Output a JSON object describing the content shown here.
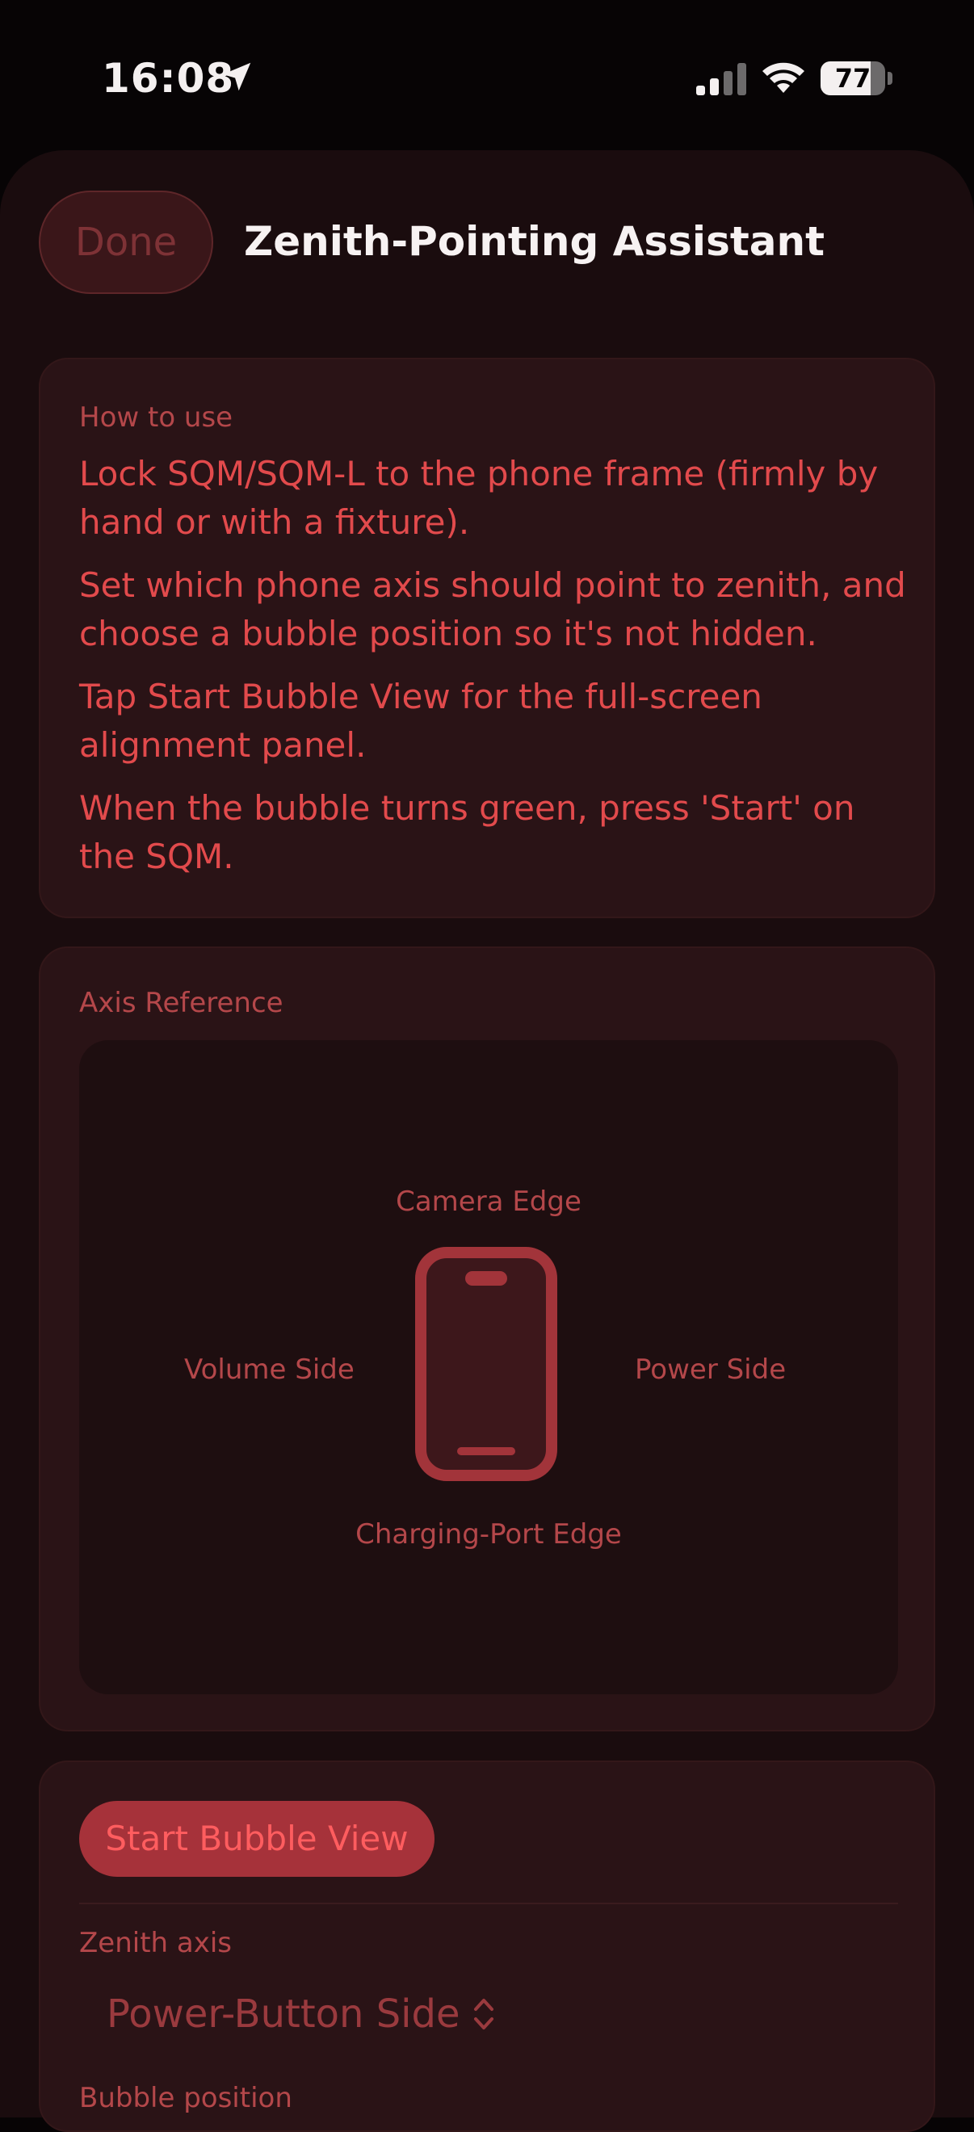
{
  "status_bar": {
    "time": "16:08",
    "battery_level": "77",
    "battery_fraction": 0.77
  },
  "nav": {
    "done_label": "Done",
    "title": "Zenith-Pointing Assistant"
  },
  "howto": {
    "heading": "How to use",
    "steps": [
      "Lock SQM/SQM-L to the phone frame (firmly by hand or with a fixture).",
      "Set which phone axis should point to zenith, and choose a bubble position so it's not hidden.",
      "Tap Start Bubble View for the full-screen alignment panel.",
      "When the bubble turns green, press 'Start' on the SQM."
    ]
  },
  "axis_reference": {
    "heading": "Axis Reference",
    "top_label": "Camera Edge",
    "bottom_label": "Charging-Port Edge",
    "left_label": "Volume Side",
    "right_label": "Power Side"
  },
  "controls": {
    "start_button_label": "Start Bubble View",
    "zenith_axis_label": "Zenith axis",
    "zenith_axis_value": "Power-Button Side",
    "bubble_position_label": "Bubble position"
  },
  "icons": {
    "location": "location-arrow-icon",
    "signal": "cellular-signal-icon",
    "wifi": "wifi-icon",
    "battery": "battery-icon",
    "phone": "phone-outline-icon",
    "chevron": "chevron-up-down-icon"
  },
  "colors": {
    "background": "#070405",
    "sheet": "#1a0c0e",
    "card": "#2a1316",
    "accent_red": "#e24a4c",
    "muted_red": "#b4474a",
    "button_fill": "#a6323a"
  }
}
